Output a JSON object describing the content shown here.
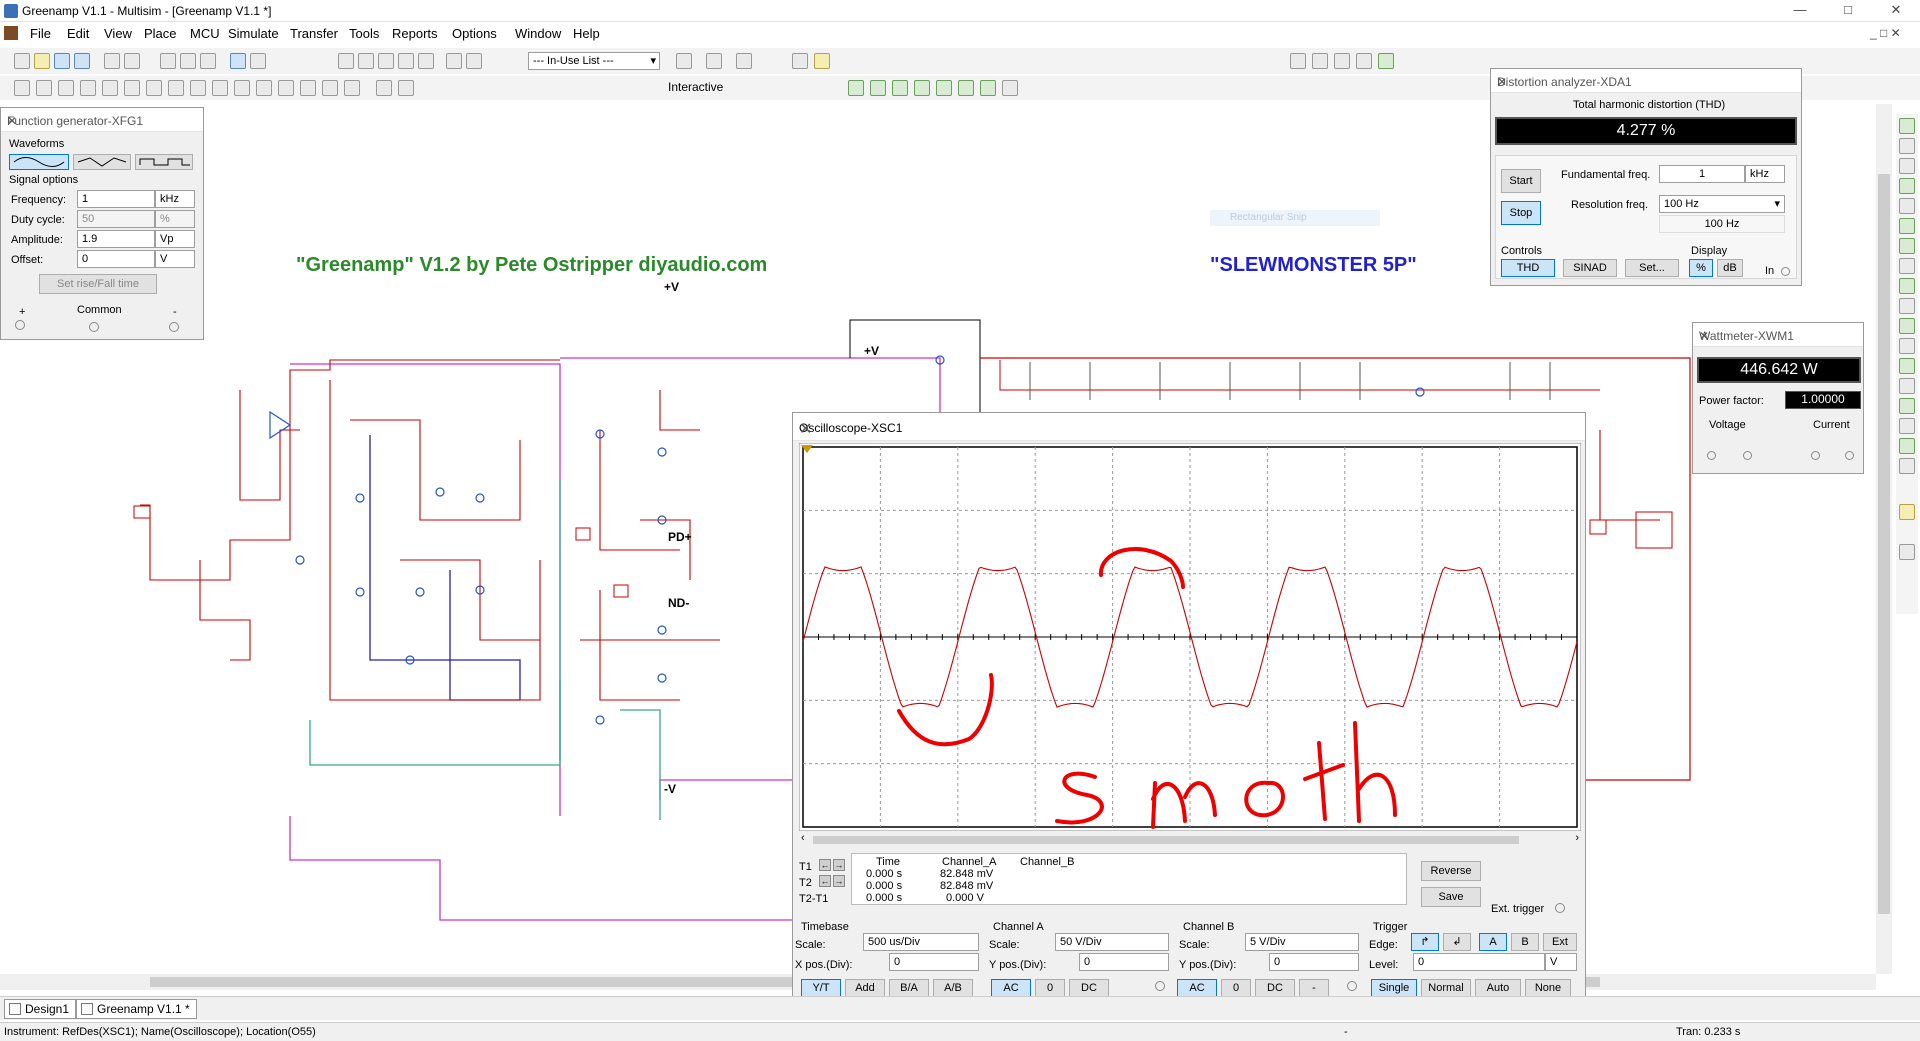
{
  "window": {
    "title": "Greenamp V1.1 - Multisim - [Greenamp V1.1 *]"
  },
  "menu": [
    "File",
    "Edit",
    "View",
    "Place",
    "MCU",
    "Simulate",
    "Transfer",
    "Tools",
    "Reports",
    "Options",
    "Window",
    "Help"
  ],
  "toolbar": {
    "inuse_list": "--- In-Use List ---",
    "interactive": "Interactive"
  },
  "function_generator": {
    "title": "Function generator-XFG1",
    "waveforms_label": "Waveforms",
    "signal_options_label": "Signal options",
    "frequency_label": "Frequency:",
    "frequency_value": "1",
    "frequency_unit": "kHz",
    "duty_label": "Duty cycle:",
    "duty_value": "50",
    "duty_unit": "%",
    "amplitude_label": "Amplitude:",
    "amplitude_value": "1.9",
    "amplitude_unit": "Vp",
    "offset_label": "Offset:",
    "offset_value": "0",
    "offset_unit": "V",
    "rise_fall_button": "Set rise/Fall time",
    "common_label": "Common",
    "plus": "+",
    "minus": "-"
  },
  "distortion_analyzer": {
    "title": "Distortion analyzer-XDA1",
    "thd_label": "Total harmonic distortion (THD)",
    "thd_value": "4.277 %",
    "start": "Start",
    "stop": "Stop",
    "fund_label": "Fundamental freq.",
    "fund_value": "1",
    "fund_unit": "kHz",
    "res_label": "Resolution freq.",
    "res_value": "100 Hz",
    "res_readout": "100 Hz",
    "controls_label": "Controls",
    "display_label": "Display",
    "thd_btn": "THD",
    "sinad_btn": "SINAD",
    "set_btn": "Set...",
    "pct_btn": "%",
    "db_btn": "dB",
    "in_label": "In"
  },
  "wattmeter": {
    "title": "Wattmeter-XWM1",
    "power": "446.642 W",
    "pf_label": "Power factor:",
    "pf_value": "1.00000",
    "voltage_label": "Voltage",
    "current_label": "Current"
  },
  "schematic": {
    "title_left": "\"Greenamp\" V1.2 by Pete Ostripper diyaudio.com",
    "title_right": "\"SLEWMONSTER 5P\"",
    "label_vplus": "+V",
    "label_vplus2": "+V",
    "label_vminus": "-V",
    "label_pd": "PD+",
    "label_nd": "ND-",
    "snip_text": "Rectangular Snip"
  },
  "oscilloscope": {
    "title": "Oscilloscope-XSC1",
    "annotation": "smoth",
    "cursor_table": {
      "headers": [
        "Time",
        "Channel_A",
        "Channel_B"
      ],
      "rows": [
        {
          "label": "T1",
          "time": "0.000 s",
          "cha": "82.848 mV",
          "chb": ""
        },
        {
          "label": "T2",
          "time": "0.000 s",
          "cha": "82.848 mV",
          "chb": ""
        },
        {
          "label": "T2-T1",
          "time": "0.000 s",
          "cha": "0.000 V",
          "chb": ""
        }
      ]
    },
    "reverse_btn": "Reverse",
    "save_btn": "Save",
    "ext_trigger": "Ext. trigger",
    "timebase": {
      "label": "Timebase",
      "scale_label": "Scale:",
      "scale": "500 us/Div",
      "xpos_label": "X pos.(Div):",
      "xpos": "0",
      "btns": [
        "Y/T",
        "Add",
        "B/A",
        "A/B"
      ]
    },
    "channel_a": {
      "label": "Channel A",
      "scale_label": "Scale:",
      "scale": "50  V/Div",
      "ypos_label": "Y pos.(Div):",
      "ypos": "0",
      "btns": [
        "AC",
        "0",
        "DC"
      ]
    },
    "channel_b": {
      "label": "Channel B",
      "scale_label": "Scale:",
      "scale": "5  V/Div",
      "ypos_label": "Y pos.(Div):",
      "ypos": "0",
      "btns": [
        "AC",
        "0",
        "DC",
        "-"
      ]
    },
    "trigger": {
      "label": "Trigger",
      "edge_label": "Edge:",
      "level_label": "Level:",
      "level": "0",
      "level_unit": "V",
      "edge_btns": [
        "A",
        "B",
        "Ext"
      ],
      "mode_btns": [
        "Single",
        "Normal",
        "Auto",
        "None"
      ]
    }
  },
  "tabs": [
    "Design1",
    "Greenamp V1.1 *"
  ],
  "status": {
    "left": "Instrument: RefDes(XSC1); Name(Oscilloscope); Location(O55)",
    "mid": "-",
    "right": "Tran: 0.233 s"
  }
}
